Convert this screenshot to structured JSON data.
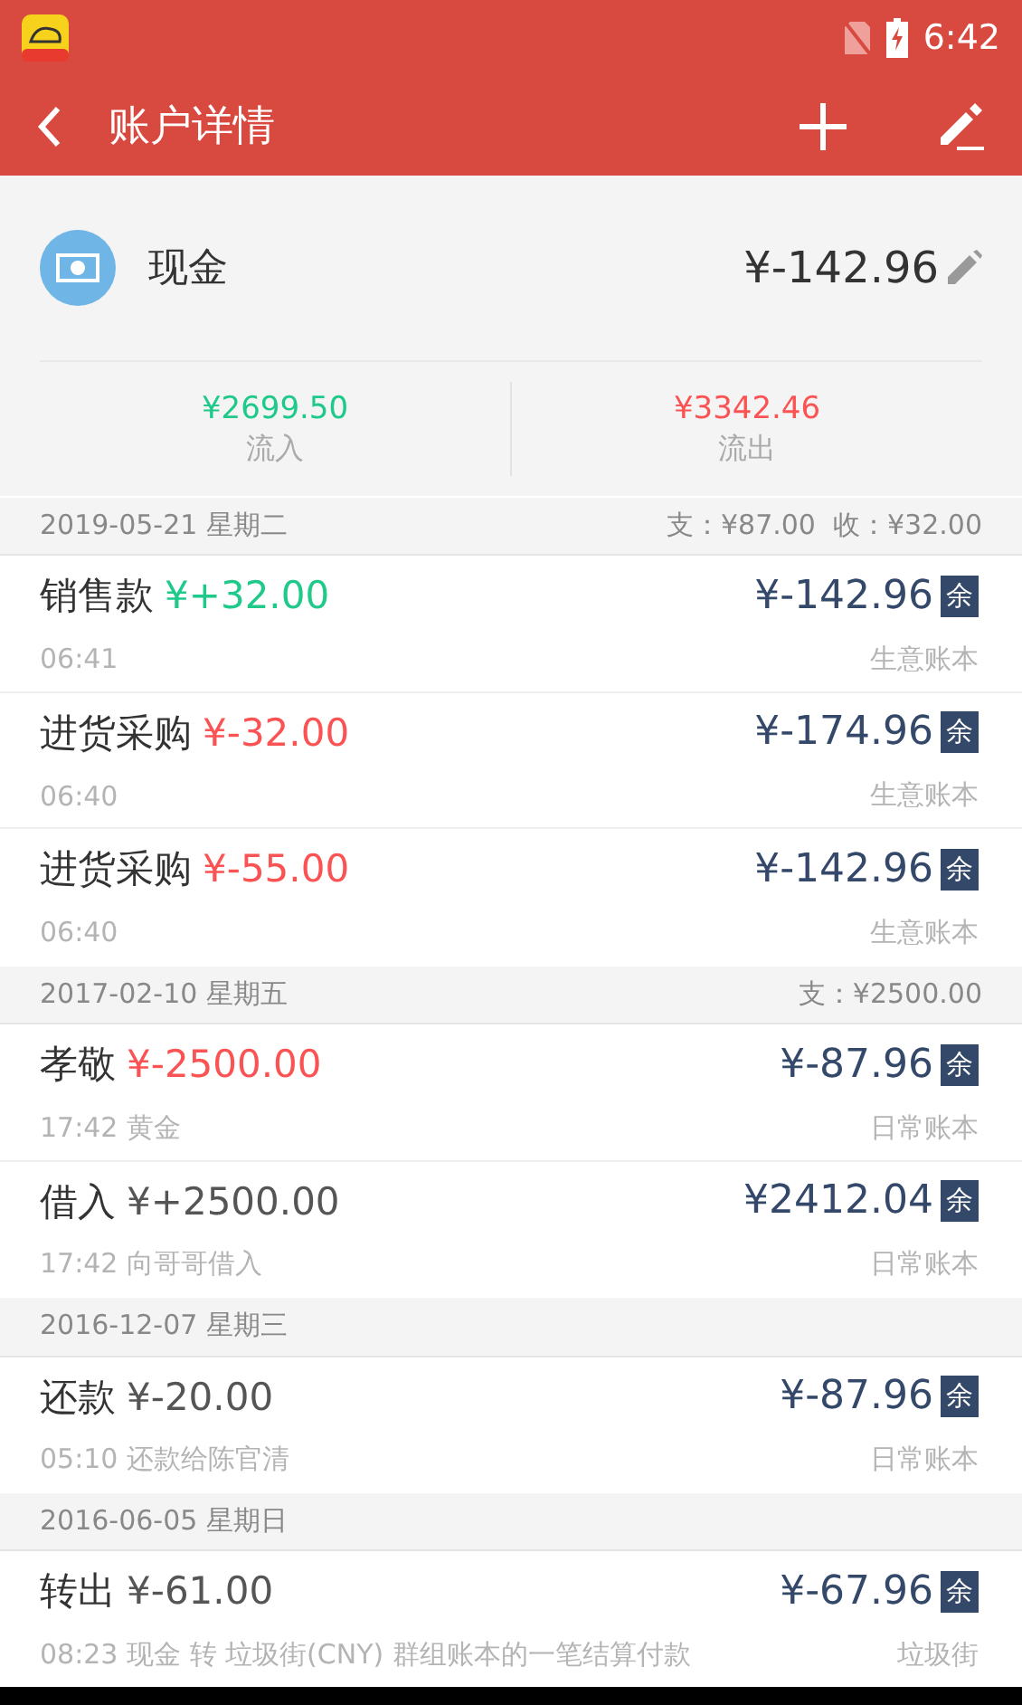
{
  "status_bar": {
    "time": "6:42"
  },
  "app_bar": {
    "title": "账户详情"
  },
  "account": {
    "name": "现金",
    "balance": "¥-142.96",
    "inflow": {
      "amount": "¥2699.50",
      "label": "流入"
    },
    "outflow": {
      "amount": "¥3342.46",
      "label": "流出"
    }
  },
  "groups": [
    {
      "date": "2019-05-21 星期二",
      "summary": "支：¥87.00  收：¥32.00",
      "rows": [
        {
          "category": "销售款",
          "amount": "¥+32.00",
          "kind": "income",
          "balance": "¥-142.96",
          "badge": "余",
          "time": "06:41",
          "book": "生意账本"
        },
        {
          "category": "进货采购",
          "amount": "¥-32.00",
          "kind": "expense",
          "balance": "¥-174.96",
          "badge": "余",
          "time": "06:40",
          "book": "生意账本"
        },
        {
          "category": "进货采购",
          "amount": "¥-55.00",
          "kind": "expense",
          "balance": "¥-142.96",
          "badge": "余",
          "time": "06:40",
          "book": "生意账本"
        }
      ]
    },
    {
      "date": "2017-02-10 星期五",
      "summary": "支：¥2500.00",
      "rows": [
        {
          "category": "孝敬",
          "amount": "¥-2500.00",
          "kind": "expense",
          "balance": "¥-87.96",
          "badge": "余",
          "time": "17:42 黄金",
          "book": "日常账本"
        },
        {
          "category": "借入",
          "amount": "¥+2500.00",
          "kind": "other",
          "balance": "¥2412.04",
          "badge": "余",
          "time": "17:42 向哥哥借入",
          "book": "日常账本"
        }
      ]
    },
    {
      "date": "2016-12-07 星期三",
      "rows": [
        {
          "category": "还款",
          "amount": "¥-20.00",
          "kind": "other",
          "balance": "¥-87.96",
          "badge": "余",
          "time": "05:10 还款给陈官清",
          "book": "日常账本"
        }
      ]
    },
    {
      "date": "2016-06-05 星期日",
      "rows": [
        {
          "category": "转出",
          "amount": "¥-61.00",
          "kind": "other",
          "balance": "¥-67.96",
          "badge": "余",
          "time": "08:23 现金 转 垃圾街(CNY) 群组账本的一笔结算付款",
          "book": "垃圾街"
        }
      ]
    }
  ]
}
